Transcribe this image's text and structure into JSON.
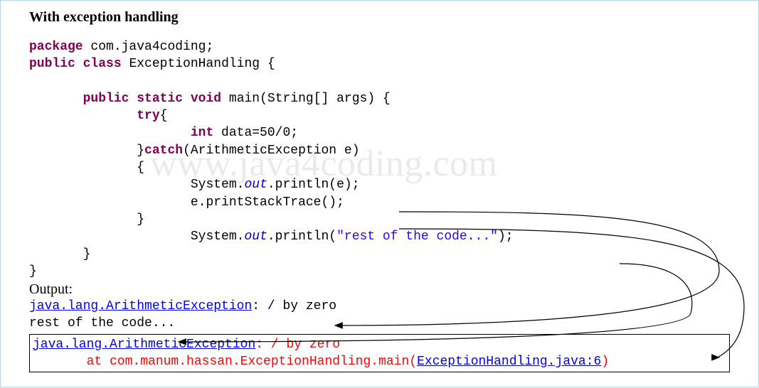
{
  "title": "With exception handling",
  "watermark": "www.java4coding.com",
  "code": {
    "kw_package": "package",
    "pkg_name": " com.java4coding;",
    "kw_public": "public",
    "kw_class": "class",
    "cls_name": " ExceptionHandling {",
    "kw_static": "static",
    "kw_void": "void",
    "main_sig_1": " main(String[] args) {",
    "kw_try": "try",
    "brace_open": "{",
    "kw_int": "int",
    "data_assign": " data=50/0;",
    "brace_close_catch_open": "}",
    "kw_catch": "catch",
    "catch_sig": "(ArithmeticException e)",
    "catch_open": "{",
    "sys": "System.",
    "out": "out",
    "println_e": ".println(e);",
    "e_pst": "e.printStackTrace();",
    "catch_close": "}",
    "println_rest_open": ".println(",
    "str_rest": "\"rest of the code...\"",
    "println_rest_close": ");",
    "method_close": "}",
    "class_close": "}"
  },
  "output": {
    "label": "Output:",
    "line1_link": "java.lang.ArithmeticException",
    "line1_tail": ": / by zero",
    "line2": "rest of the code..."
  },
  "trace": {
    "line1_a": "java.lang.ArithmeticException",
    "line1_b": ": / by zero",
    "line2_prefix": "       at com.manum.hassan.ExceptionHandling.main(",
    "line2_link": "ExceptionHandling.java:6",
    "line2_suffix": ")"
  },
  "arrows": {
    "note": "three arrows: println(e)→output line1, printStackTrace()→trace box, println(rest)→output line2"
  }
}
